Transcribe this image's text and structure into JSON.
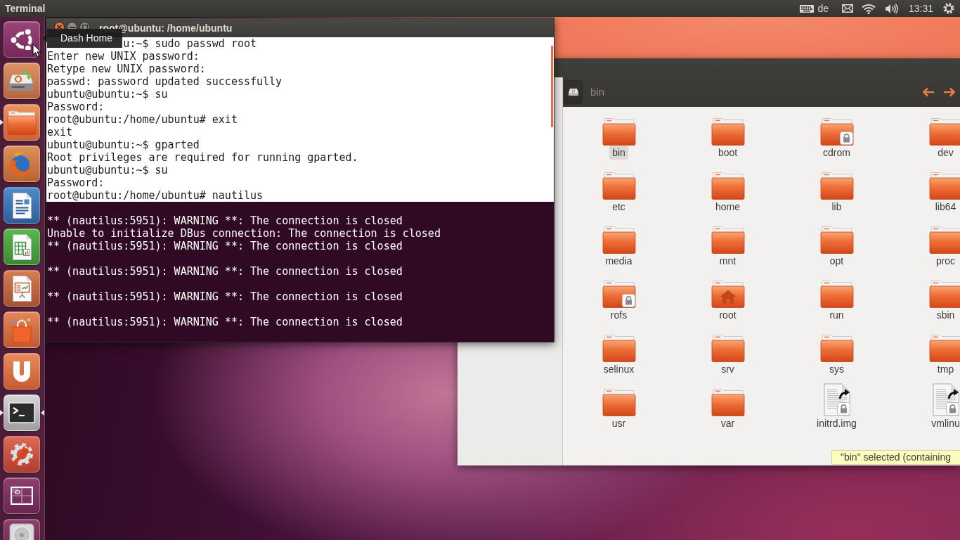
{
  "top_panel": {
    "app_title": "Terminal",
    "keyboard_layout": "de",
    "clock": "13:31"
  },
  "launcher": {
    "tooltip": "Dash Home",
    "items": [
      {
        "kind": "dash",
        "running": false,
        "focused": false
      },
      {
        "kind": "installer",
        "running": false,
        "focused": false
      },
      {
        "kind": "files",
        "running": true,
        "focused": false
      },
      {
        "kind": "browser",
        "running": false,
        "focused": false
      },
      {
        "kind": "writer",
        "running": false,
        "focused": false
      },
      {
        "kind": "calc",
        "running": false,
        "focused": false
      },
      {
        "kind": "impress",
        "running": false,
        "focused": false
      },
      {
        "kind": "store",
        "running": false,
        "focused": false
      },
      {
        "kind": "cloud",
        "running": false,
        "focused": false
      },
      {
        "kind": "terminal",
        "running": true,
        "focused": true
      },
      {
        "kind": "settings",
        "running": false,
        "focused": false
      },
      {
        "kind": "workspaces",
        "running": false,
        "focused": false
      },
      {
        "kind": "disk",
        "running": false,
        "focused": false
      }
    ]
  },
  "terminal": {
    "title": "root@ubuntu: /home/ubuntu",
    "blocks": [
      {
        "kind": "light",
        "lines": [
          {
            "kind": "covered",
            "text": "u:~$ sudo passwd root"
          },
          {
            "kind": "text",
            "text": "Enter new UNIX password:"
          },
          {
            "kind": "text",
            "text": "Retype new UNIX password:"
          },
          {
            "kind": "text",
            "text": "passwd: password updated successfully"
          },
          {
            "kind": "text",
            "text": "ubuntu@ubuntu:~$ su"
          },
          {
            "kind": "text",
            "text": "Password:"
          },
          {
            "kind": "text",
            "text": "root@ubuntu:/home/ubuntu# exit"
          },
          {
            "kind": "text",
            "text": "exit"
          },
          {
            "kind": "text",
            "text": "ubuntu@ubuntu:~$ gparted"
          },
          {
            "kind": "text",
            "text": "Root privileges are required for running gparted."
          },
          {
            "kind": "text",
            "text": "ubuntu@ubuntu:~$ su"
          },
          {
            "kind": "text",
            "text": "Password:"
          },
          {
            "kind": "text",
            "text": "root@ubuntu:/home/ubuntu# nautilus"
          }
        ]
      },
      {
        "kind": "dark",
        "lines": [
          {
            "kind": "blank"
          },
          {
            "kind": "text",
            "text": "** (nautilus:5951): WARNING **: The connection is closed"
          },
          {
            "kind": "text",
            "text": "Unable to initialize DBus connection: The connection is closed"
          },
          {
            "kind": "text",
            "text": "** (nautilus:5951): WARNING **: The connection is closed"
          },
          {
            "kind": "blank"
          },
          {
            "kind": "text",
            "text": "** (nautilus:5951): WARNING **: The connection is closed"
          },
          {
            "kind": "blank"
          },
          {
            "kind": "text",
            "text": "** (nautilus:5951): WARNING **: The connection is closed"
          },
          {
            "kind": "blank"
          },
          {
            "kind": "text",
            "text": "** (nautilus:5951): WARNING **: The connection is closed"
          }
        ]
      }
    ]
  },
  "file_manager": {
    "location": "bin",
    "items": [
      {
        "name": "bin",
        "kind": "folder",
        "locked": false,
        "selected": true
      },
      {
        "name": "boot",
        "kind": "folder",
        "locked": false,
        "selected": false
      },
      {
        "name": "cdrom",
        "kind": "folder",
        "locked": true,
        "selected": false
      },
      {
        "name": "dev",
        "kind": "folder",
        "locked": false,
        "selected": false
      },
      {
        "name": "etc",
        "kind": "folder",
        "locked": false,
        "selected": false
      },
      {
        "name": "home",
        "kind": "folder",
        "locked": false,
        "selected": false
      },
      {
        "name": "lib",
        "kind": "folder",
        "locked": false,
        "selected": false
      },
      {
        "name": "lib64",
        "kind": "folder",
        "locked": false,
        "selected": false
      },
      {
        "name": "media",
        "kind": "folder",
        "locked": false,
        "selected": false
      },
      {
        "name": "mnt",
        "kind": "folder",
        "locked": false,
        "selected": false
      },
      {
        "name": "opt",
        "kind": "folder",
        "locked": false,
        "selected": false
      },
      {
        "name": "proc",
        "kind": "folder",
        "locked": false,
        "selected": false
      },
      {
        "name": "rofs",
        "kind": "folder",
        "locked": true,
        "selected": false
      },
      {
        "name": "root",
        "kind": "home",
        "locked": false,
        "selected": false
      },
      {
        "name": "run",
        "kind": "folder",
        "locked": false,
        "selected": false
      },
      {
        "name": "sbin",
        "kind": "folder",
        "locked": false,
        "selected": false
      },
      {
        "name": "selinux",
        "kind": "folder",
        "locked": false,
        "selected": false
      },
      {
        "name": "srv",
        "kind": "folder",
        "locked": false,
        "selected": false
      },
      {
        "name": "sys",
        "kind": "folder",
        "locked": false,
        "selected": false
      },
      {
        "name": "tmp",
        "kind": "folder",
        "locked": false,
        "selected": false
      },
      {
        "name": "usr",
        "kind": "folder",
        "locked": false,
        "selected": false
      },
      {
        "name": "var",
        "kind": "folder",
        "locked": false,
        "selected": false
      },
      {
        "name": "initrd.img",
        "kind": "link",
        "locked": true,
        "selected": false
      },
      {
        "name": "vmlinu",
        "kind": "link",
        "locked": true,
        "selected": false
      }
    ],
    "status": "\"bin\" selected (containing"
  }
}
